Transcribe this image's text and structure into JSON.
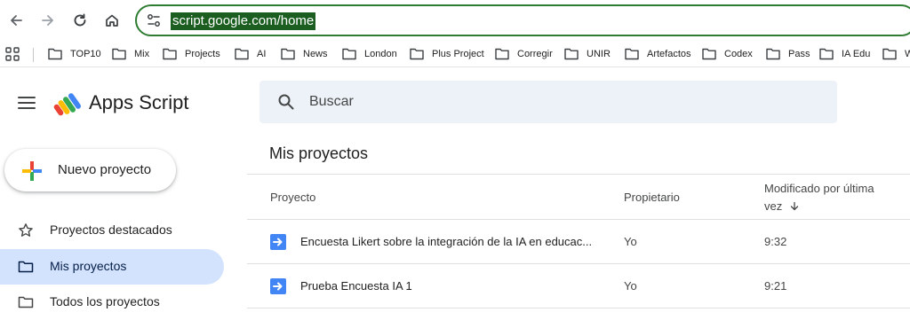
{
  "browser": {
    "url": "script.google.com/home",
    "bookmarks": [
      "TOP10",
      "Mix",
      "Projects",
      "AI",
      "News",
      "London",
      "Plus Project",
      "Corregir",
      "UNIR",
      "Artefactos",
      "Codex",
      "Pass",
      "IA Edu",
      "W"
    ]
  },
  "app": {
    "title": "Apps Script",
    "search_placeholder": "Buscar",
    "new_project_label": "Nuevo proyecto"
  },
  "sidebar": {
    "items": [
      {
        "label": "Proyectos destacados",
        "icon": "star-icon"
      },
      {
        "label": "Mis proyectos",
        "icon": "folder-icon",
        "active": true
      },
      {
        "label": "Todos los proyectos",
        "icon": "folder-icon"
      }
    ]
  },
  "main": {
    "section_title": "Mis proyectos",
    "columns": {
      "project": "Proyecto",
      "owner": "Propietario",
      "modified": "Modificado por última",
      "modified_line2": "vez",
      "sort_icon": "arrow-down-icon"
    },
    "rows": [
      {
        "name": "Encuesta Likert sobre la integración de la IA en educac...",
        "owner": "Yo",
        "modified": "9:32"
      },
      {
        "name": "Prueba Encuesta IA 1",
        "owner": "Yo",
        "modified": "9:21"
      }
    ]
  },
  "colors": {
    "omnibox_border": "#2e7d32",
    "url_highlight": "#1b5e20",
    "active_item": "#d3e3fd",
    "search_bg": "#edf1f8",
    "project_icon": "#4285f4"
  }
}
